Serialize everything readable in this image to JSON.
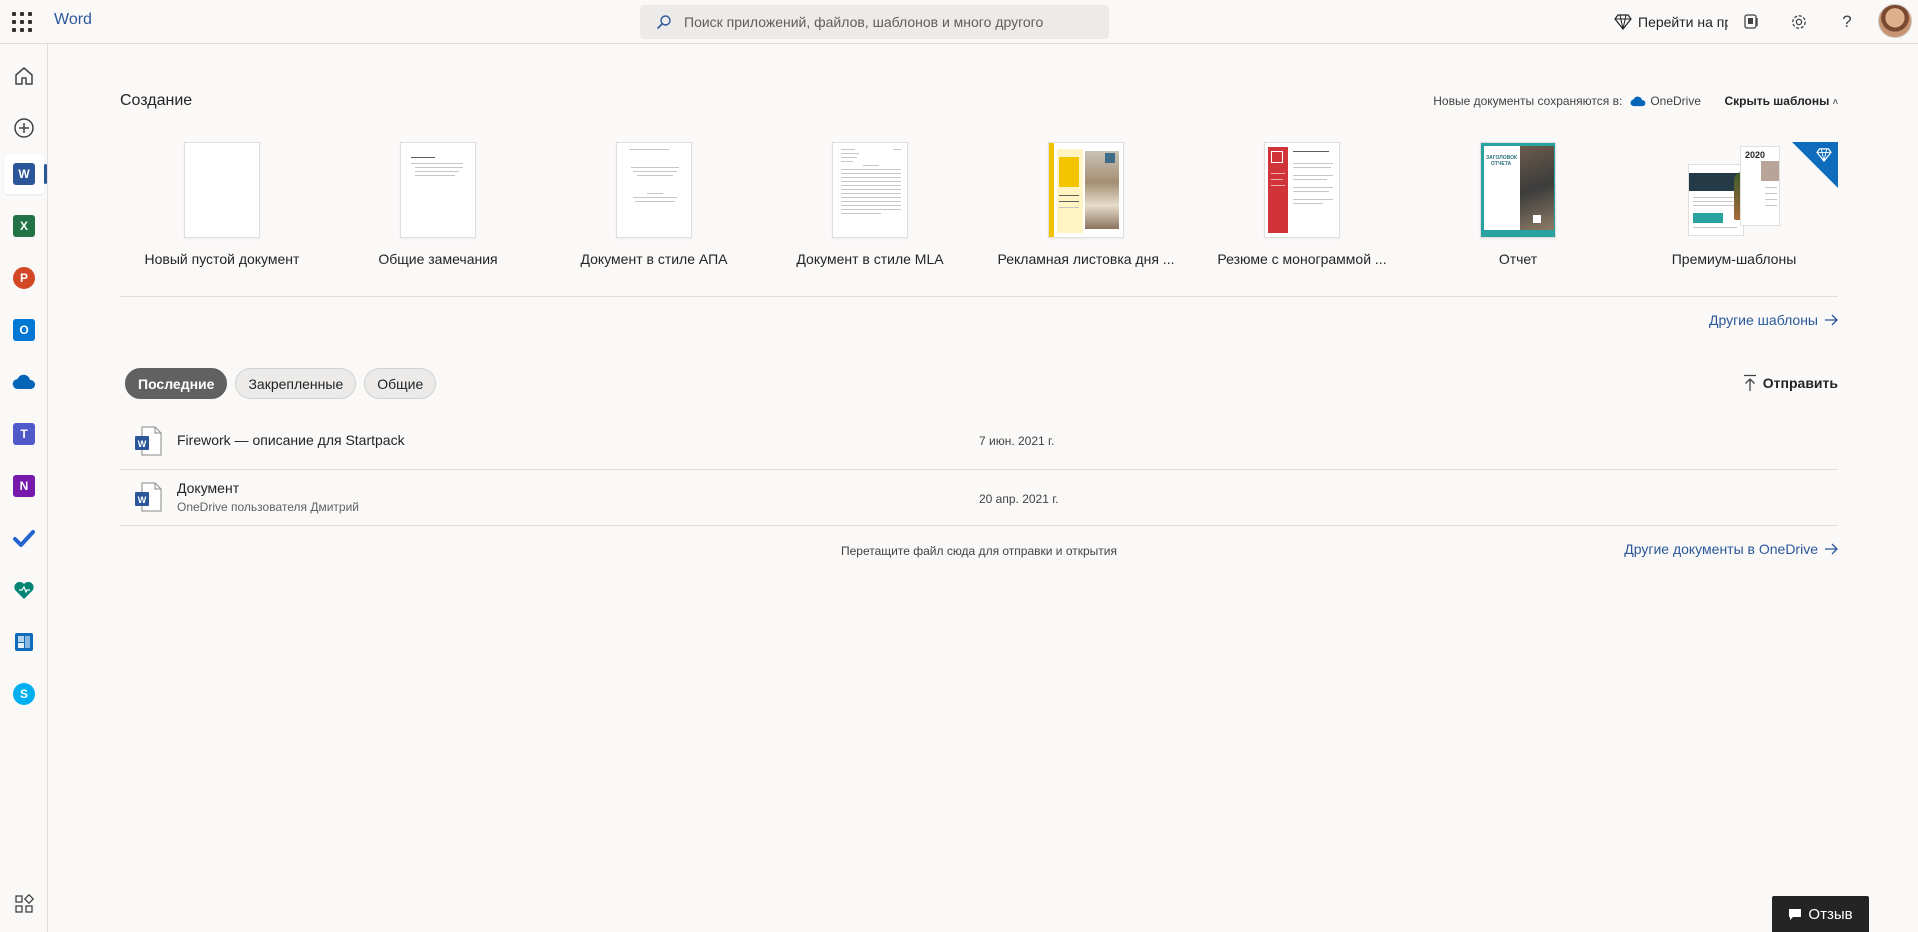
{
  "app": {
    "name": "Word"
  },
  "search": {
    "placeholder": "Поиск приложений, файлов, шаблонов и много другого"
  },
  "header": {
    "premium_label": "Перейти на премиум"
  },
  "create": {
    "title": "Создание",
    "save_label": "Новые документы сохраняются в:",
    "save_location": "OneDrive",
    "hide_templates": "Скрыть шаблоны"
  },
  "templates": [
    {
      "label": "Новый пустой документ"
    },
    {
      "label": "Общие замечания"
    },
    {
      "label": "Документ в стиле АПА"
    },
    {
      "label": "Документ в стиле MLA"
    },
    {
      "label": "Рекламная листовка дня ..."
    },
    {
      "label": "Резюме с монограммой ..."
    },
    {
      "label": "Отчет"
    },
    {
      "label": "Премиум-шаблоны"
    }
  ],
  "template_thumb_text": {
    "report_title": "ЗАГОЛОВОК ОТЧЕТА",
    "premium_year": "2020"
  },
  "more_templates": "Другие шаблоны",
  "tabs": [
    {
      "label": "Последние"
    },
    {
      "label": "Закрепленные"
    },
    {
      "label": "Общие"
    }
  ],
  "upload_label": "Отправить",
  "files": [
    {
      "name": "Firework — описание для Startpack",
      "location": "",
      "date": "7 июн. 2021 г."
    },
    {
      "name": "Документ",
      "location": "OneDrive пользователя Дмитрий",
      "date": "20 апр. 2021 г."
    }
  ],
  "drop_hint": "Перетащите файл сюда для отправки и открытия",
  "more_docs": "Другие документы в OneDrive",
  "feedback_label": "Отзыв",
  "colors": {
    "word": "#2b579a",
    "excel": "#217346",
    "powerpoint": "#d24726",
    "outlook": "#0078d4",
    "onedrive": "#0364b8",
    "teams": "#5059c9",
    "onenote": "#7719aa",
    "todo": "#2564cf"
  }
}
